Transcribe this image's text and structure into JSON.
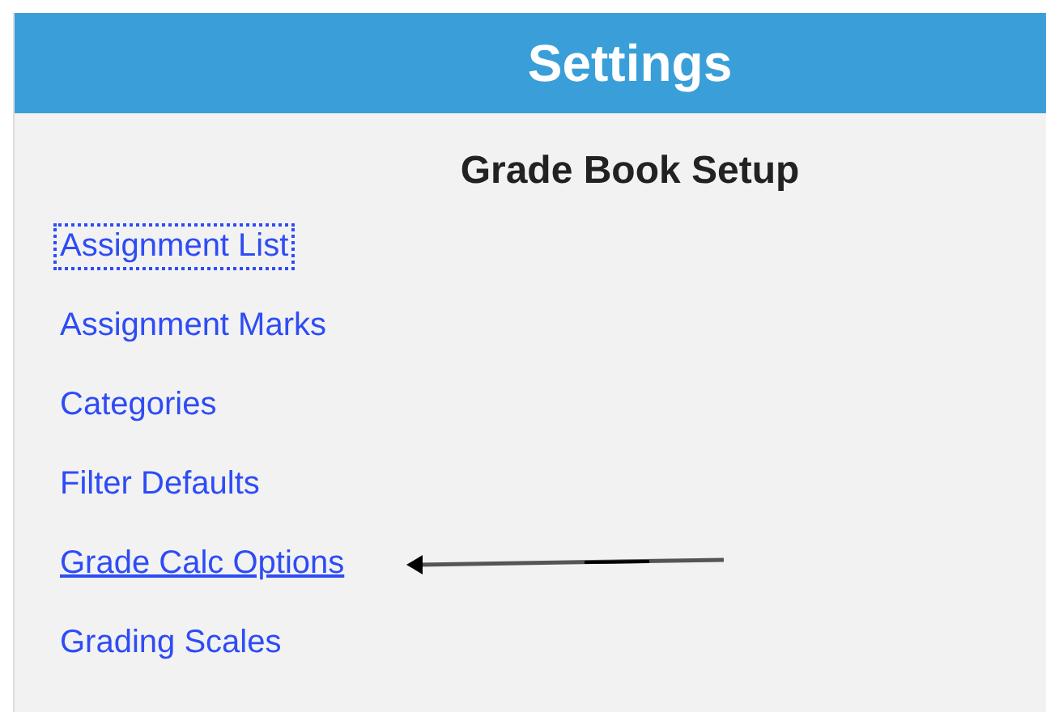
{
  "header": {
    "title": "Settings"
  },
  "section": {
    "title": "Grade Book Setup"
  },
  "links": [
    {
      "label": "Assignment List",
      "focused": true,
      "hovered": false,
      "pointer": false
    },
    {
      "label": "Assignment Marks",
      "focused": false,
      "hovered": false,
      "pointer": false
    },
    {
      "label": "Categories",
      "focused": false,
      "hovered": false,
      "pointer": false
    },
    {
      "label": "Filter Defaults",
      "focused": false,
      "hovered": false,
      "pointer": false
    },
    {
      "label": "Grade Calc Options",
      "focused": false,
      "hovered": true,
      "pointer": true
    },
    {
      "label": "Grading Scales",
      "focused": false,
      "hovered": false,
      "pointer": false
    }
  ]
}
